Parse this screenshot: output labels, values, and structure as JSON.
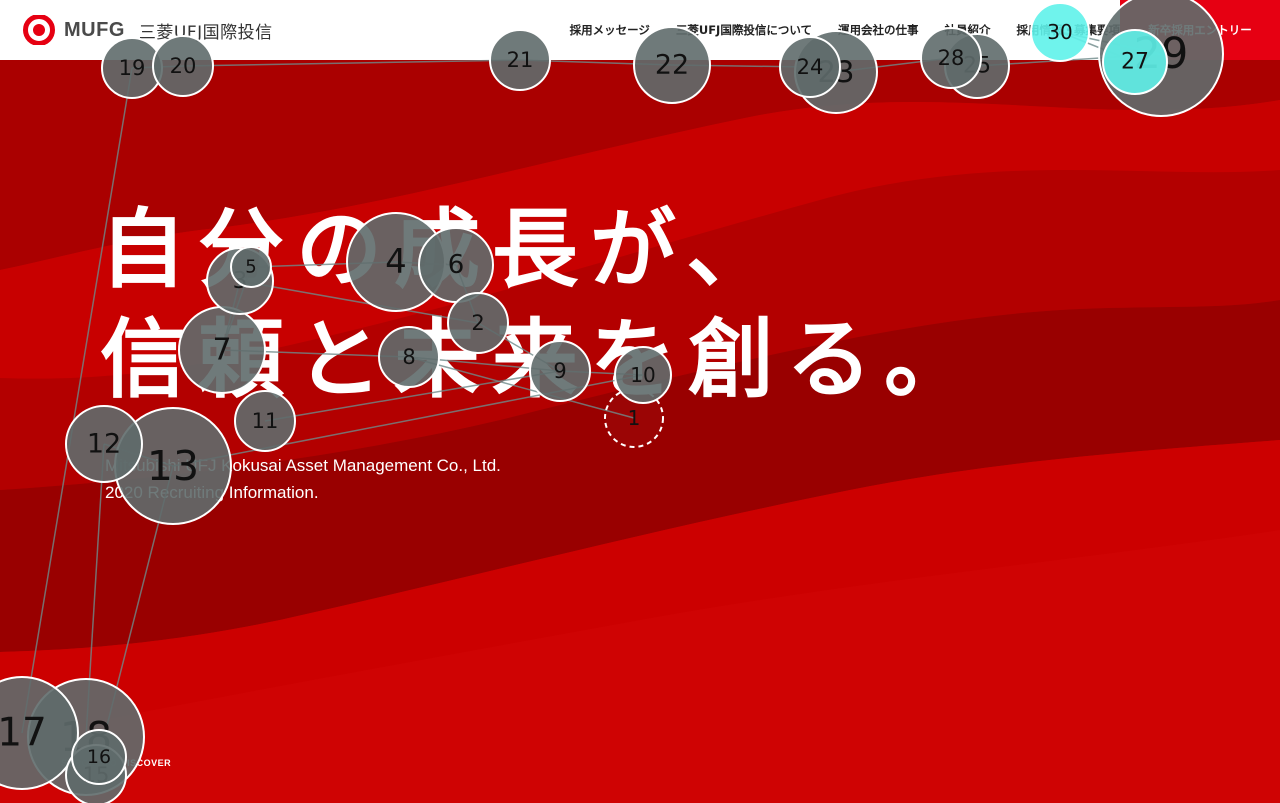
{
  "header": {
    "brand": "MUFG",
    "company": "三菱UFJ国際投信",
    "nav": [
      "採用メッセージ",
      "三菱UFJ国際投信について",
      "運用会社の仕事",
      "社員紹介",
      "採用情報・募集要項"
    ],
    "entry_label": "新卒採用エントリー"
  },
  "hero": {
    "headline_line1": "自分の成長が、",
    "headline_line2": "信頼と未来を創る。",
    "sub_line1": "Mitsubishi UFJ Kokusai Asset Management Co., Ltd.",
    "sub_line2": "2020 Recruiting Information.",
    "scroll_label": "SCROLL TO DISCOVER"
  },
  "colors": {
    "brand_red": "#e60012",
    "hero_red": "#c00000",
    "marker_fill": "#5f6b6b",
    "marker_highlight": "#5ff2ea"
  },
  "icons": {
    "logo": "mufg-logo-icon"
  },
  "overlay_markers": [
    {
      "label": "1"
    },
    {
      "label": "2"
    },
    {
      "label": "3"
    },
    {
      "label": "4"
    },
    {
      "label": "5"
    },
    {
      "label": "6"
    },
    {
      "label": "7"
    },
    {
      "label": "8"
    },
    {
      "label": "9"
    },
    {
      "label": "10"
    },
    {
      "label": "11"
    },
    {
      "label": "12"
    },
    {
      "label": "13"
    },
    {
      "label": "15"
    },
    {
      "label": "16"
    },
    {
      "label": "17"
    },
    {
      "label": "18"
    },
    {
      "label": "19"
    },
    {
      "label": "20"
    },
    {
      "label": "21"
    },
    {
      "label": "22"
    },
    {
      "label": "23"
    },
    {
      "label": "24"
    },
    {
      "label": "25"
    },
    {
      "label": "27"
    },
    {
      "label": "28"
    },
    {
      "label": "29"
    },
    {
      "label": "30"
    }
  ]
}
